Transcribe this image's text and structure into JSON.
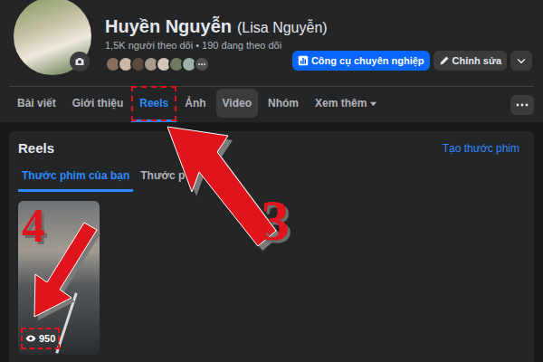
{
  "profile": {
    "name": "Huyền Nguyễn",
    "alt_name": "(Lisa Nguyễn)",
    "stats": "1,5K người theo dõi • 190 đang theo dõi"
  },
  "buttons": [
    {
      "label": "Công cụ chuyên nghiệp",
      "kind": "primary"
    },
    {
      "label": "Chỉnh sửa",
      "kind": "secondary"
    }
  ],
  "tabs": [
    {
      "label": "Bài viết",
      "selected": false,
      "hovered": false,
      "annotated": false,
      "kind": "link"
    },
    {
      "label": "Giới thiệu",
      "selected": false,
      "hovered": false,
      "annotated": false,
      "kind": "link"
    },
    {
      "label": "Reels",
      "selected": true,
      "hovered": false,
      "annotated": true,
      "kind": "link"
    },
    {
      "label": "Ảnh",
      "selected": false,
      "hovered": false,
      "annotated": false,
      "kind": "link"
    },
    {
      "label": "Video",
      "selected": false,
      "hovered": true,
      "annotated": false,
      "kind": "link"
    },
    {
      "label": "Nhóm",
      "selected": false,
      "hovered": false,
      "annotated": false,
      "kind": "link"
    },
    {
      "label": "Xem thêm",
      "selected": false,
      "hovered": false,
      "annotated": false,
      "kind": "menu"
    }
  ],
  "reels": {
    "title": "Reels",
    "create_label": "Tạo thước phim",
    "subtabs": [
      {
        "label": "Thước phim của bạn",
        "selected": true
      },
      {
        "label": "Thước p",
        "selected": false
      }
    ],
    "items": [
      {
        "views": "950",
        "annotated": true
      }
    ]
  },
  "annotations": [
    {
      "label": "3"
    },
    {
      "label": "4"
    }
  ]
}
